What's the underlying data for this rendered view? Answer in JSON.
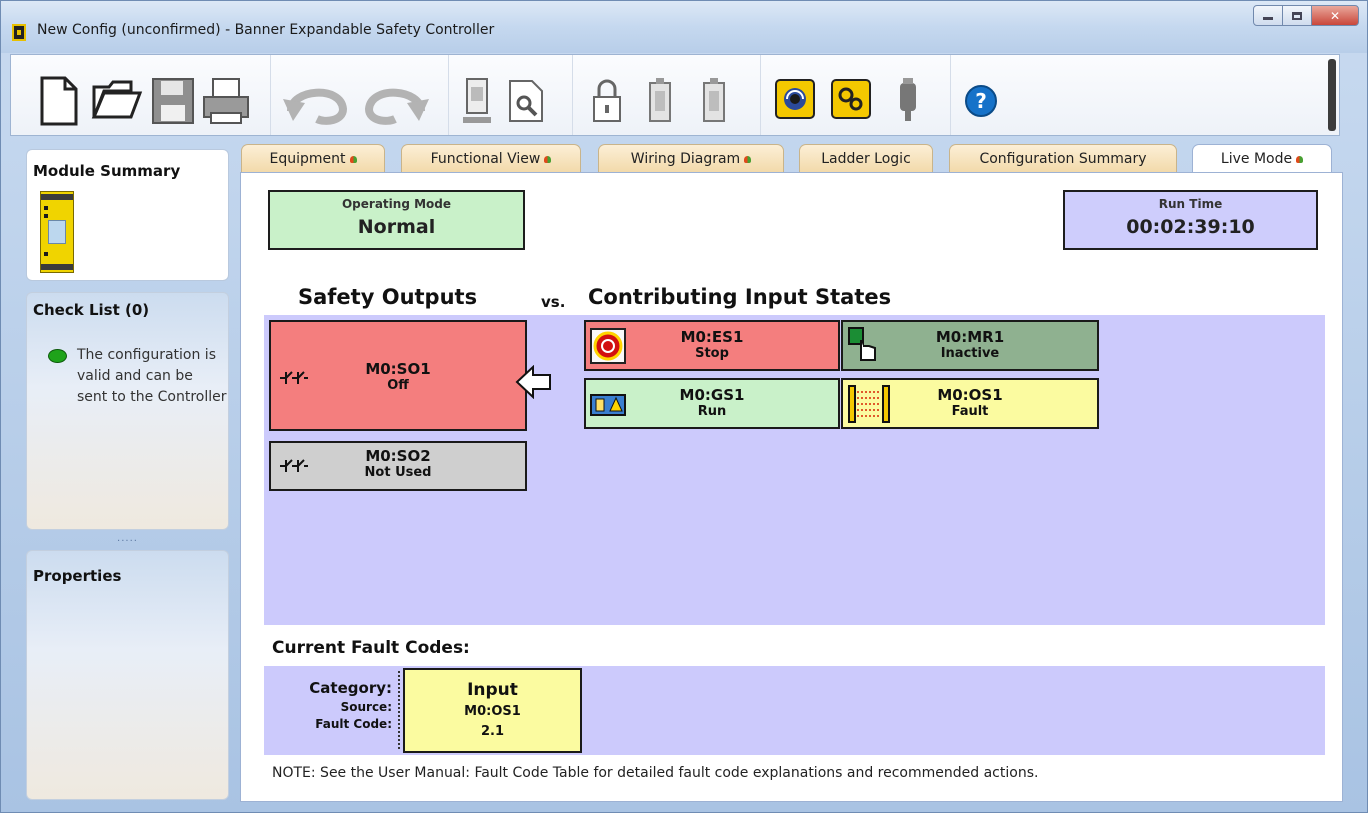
{
  "window": {
    "title": "New Config (unconfirmed) - Banner Expandable Safety Controller",
    "minimize_icon": "minimize-icon",
    "maximize_icon": "maximize-icon",
    "close_icon": "close-icon"
  },
  "toolbar": {
    "icons": [
      "new-file-icon",
      "open-folder-icon",
      "save-icon",
      "print-icon",
      "undo-icon",
      "redo-icon",
      "module-icon",
      "search-document-icon",
      "lock-icon",
      "upload-device-icon",
      "download-device-icon",
      "live-mode-icon",
      "simulation-icon",
      "usb-icon",
      "help-icon"
    ],
    "help_label": "?"
  },
  "left_panel": {
    "module_summary": {
      "title": "Module Summary"
    },
    "check_list": {
      "title": "Check List (0)",
      "status_color": "#1fa31a",
      "message": "The configuration is valid and can be sent to the Controller"
    },
    "splitter": ".....",
    "properties": {
      "title": "Properties"
    }
  },
  "tabs": [
    {
      "label": "Equipment",
      "warn": true
    },
    {
      "label": "Functional View",
      "warn": true
    },
    {
      "label": "Wiring Diagram",
      "warn": true
    },
    {
      "label": "Ladder Logic",
      "warn": false
    },
    {
      "label": "Configuration Summary",
      "warn": false
    },
    {
      "label": "Live Mode",
      "warn": true,
      "active": true
    }
  ],
  "live": {
    "operating_mode": {
      "label": "Operating Mode",
      "value": "Normal"
    },
    "run_time": {
      "label": "Run Time",
      "value": "00:02:39:10"
    },
    "safety_outputs_heading": "Safety Outputs",
    "vs": "vs.",
    "inputs_heading": "Contributing Input States",
    "outputs": [
      {
        "id": "M0:SO1",
        "state": "Off",
        "color": "#f47e7e"
      },
      {
        "id": "M0:SO2",
        "state": "Not Used",
        "color": "#cfcfcf"
      }
    ],
    "inputs": [
      {
        "id": "M0:ES1",
        "state": "Stop",
        "color": "#f47e7e",
        "icon": "emergency-stop-icon"
      },
      {
        "id": "M0:MR1",
        "state": "Inactive",
        "color": "#8fb190",
        "icon": "manual-reset-icon"
      },
      {
        "id": "M0:GS1",
        "state": "Run",
        "color": "#c9f1c9",
        "icon": "gate-switch-icon"
      },
      {
        "id": "M0:OS1",
        "state": "Fault",
        "color": "#fbfba0",
        "icon": "optical-sensor-icon"
      }
    ]
  },
  "faults": {
    "heading": "Current Fault Codes:",
    "category_label": "Category:",
    "source_label": "Source:",
    "code_label": "Fault Code:",
    "category": "Input",
    "source": "M0:OS1",
    "code": "2.1",
    "note": "NOTE: See the User Manual: Fault Code Table for detailed fault code explanations and recommended actions."
  }
}
